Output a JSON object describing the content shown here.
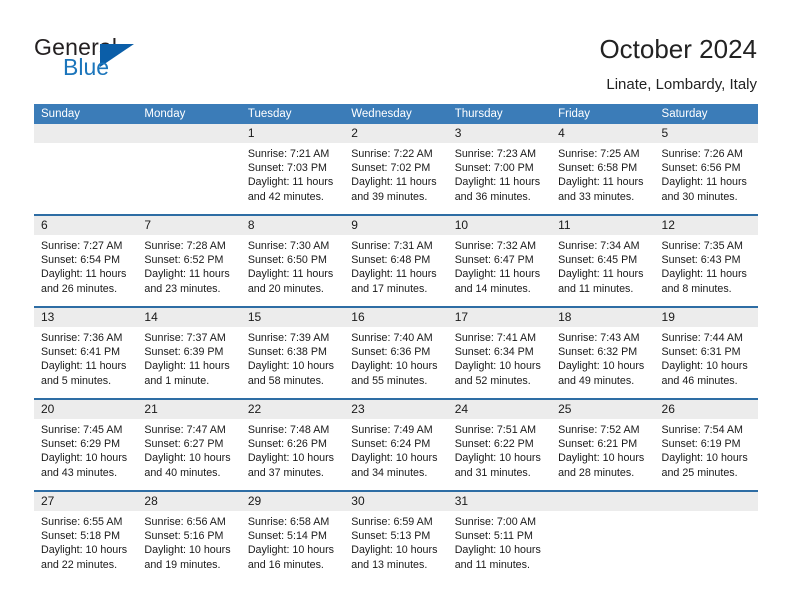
{
  "brand": {
    "name_top": "General",
    "name_bottom": "Blue",
    "triangle_color": "#0b5ea8",
    "blue_text_color": "#1b75bb"
  },
  "header": {
    "title": "October 2024",
    "location": "Linate, Lombardy, Italy"
  },
  "theme": {
    "header_bar": "#3b7cb8",
    "row_divider": "#2e6da4",
    "daynum_bg": "#ececec",
    "text": "#1a1a1a"
  },
  "weekdays": [
    "Sunday",
    "Monday",
    "Tuesday",
    "Wednesday",
    "Thursday",
    "Friday",
    "Saturday"
  ],
  "labels": {
    "sunrise": "Sunrise:",
    "sunset": "Sunset:",
    "daylight": "Daylight:"
  },
  "weeks": [
    [
      {
        "day": "",
        "blank": true
      },
      {
        "day": "",
        "blank": true
      },
      {
        "day": "1",
        "sunrise": "Sunrise: 7:21 AM",
        "sunset": "Sunset: 7:03 PM",
        "daylight1": "Daylight: 11 hours",
        "daylight2": "and 42 minutes."
      },
      {
        "day": "2",
        "sunrise": "Sunrise: 7:22 AM",
        "sunset": "Sunset: 7:02 PM",
        "daylight1": "Daylight: 11 hours",
        "daylight2": "and 39 minutes."
      },
      {
        "day": "3",
        "sunrise": "Sunrise: 7:23 AM",
        "sunset": "Sunset: 7:00 PM",
        "daylight1": "Daylight: 11 hours",
        "daylight2": "and 36 minutes."
      },
      {
        "day": "4",
        "sunrise": "Sunrise: 7:25 AM",
        "sunset": "Sunset: 6:58 PM",
        "daylight1": "Daylight: 11 hours",
        "daylight2": "and 33 minutes."
      },
      {
        "day": "5",
        "sunrise": "Sunrise: 7:26 AM",
        "sunset": "Sunset: 6:56 PM",
        "daylight1": "Daylight: 11 hours",
        "daylight2": "and 30 minutes."
      }
    ],
    [
      {
        "day": "6",
        "sunrise": "Sunrise: 7:27 AM",
        "sunset": "Sunset: 6:54 PM",
        "daylight1": "Daylight: 11 hours",
        "daylight2": "and 26 minutes."
      },
      {
        "day": "7",
        "sunrise": "Sunrise: 7:28 AM",
        "sunset": "Sunset: 6:52 PM",
        "daylight1": "Daylight: 11 hours",
        "daylight2": "and 23 minutes."
      },
      {
        "day": "8",
        "sunrise": "Sunrise: 7:30 AM",
        "sunset": "Sunset: 6:50 PM",
        "daylight1": "Daylight: 11 hours",
        "daylight2": "and 20 minutes."
      },
      {
        "day": "9",
        "sunrise": "Sunrise: 7:31 AM",
        "sunset": "Sunset: 6:48 PM",
        "daylight1": "Daylight: 11 hours",
        "daylight2": "and 17 minutes."
      },
      {
        "day": "10",
        "sunrise": "Sunrise: 7:32 AM",
        "sunset": "Sunset: 6:47 PM",
        "daylight1": "Daylight: 11 hours",
        "daylight2": "and 14 minutes."
      },
      {
        "day": "11",
        "sunrise": "Sunrise: 7:34 AM",
        "sunset": "Sunset: 6:45 PM",
        "daylight1": "Daylight: 11 hours",
        "daylight2": "and 11 minutes."
      },
      {
        "day": "12",
        "sunrise": "Sunrise: 7:35 AM",
        "sunset": "Sunset: 6:43 PM",
        "daylight1": "Daylight: 11 hours",
        "daylight2": "and 8 minutes."
      }
    ],
    [
      {
        "day": "13",
        "sunrise": "Sunrise: 7:36 AM",
        "sunset": "Sunset: 6:41 PM",
        "daylight1": "Daylight: 11 hours",
        "daylight2": "and 5 minutes."
      },
      {
        "day": "14",
        "sunrise": "Sunrise: 7:37 AM",
        "sunset": "Sunset: 6:39 PM",
        "daylight1": "Daylight: 11 hours",
        "daylight2": "and 1 minute."
      },
      {
        "day": "15",
        "sunrise": "Sunrise: 7:39 AM",
        "sunset": "Sunset: 6:38 PM",
        "daylight1": "Daylight: 10 hours",
        "daylight2": "and 58 minutes."
      },
      {
        "day": "16",
        "sunrise": "Sunrise: 7:40 AM",
        "sunset": "Sunset: 6:36 PM",
        "daylight1": "Daylight: 10 hours",
        "daylight2": "and 55 minutes."
      },
      {
        "day": "17",
        "sunrise": "Sunrise: 7:41 AM",
        "sunset": "Sunset: 6:34 PM",
        "daylight1": "Daylight: 10 hours",
        "daylight2": "and 52 minutes."
      },
      {
        "day": "18",
        "sunrise": "Sunrise: 7:43 AM",
        "sunset": "Sunset: 6:32 PM",
        "daylight1": "Daylight: 10 hours",
        "daylight2": "and 49 minutes."
      },
      {
        "day": "19",
        "sunrise": "Sunrise: 7:44 AM",
        "sunset": "Sunset: 6:31 PM",
        "daylight1": "Daylight: 10 hours",
        "daylight2": "and 46 minutes."
      }
    ],
    [
      {
        "day": "20",
        "sunrise": "Sunrise: 7:45 AM",
        "sunset": "Sunset: 6:29 PM",
        "daylight1": "Daylight: 10 hours",
        "daylight2": "and 43 minutes."
      },
      {
        "day": "21",
        "sunrise": "Sunrise: 7:47 AM",
        "sunset": "Sunset: 6:27 PM",
        "daylight1": "Daylight: 10 hours",
        "daylight2": "and 40 minutes."
      },
      {
        "day": "22",
        "sunrise": "Sunrise: 7:48 AM",
        "sunset": "Sunset: 6:26 PM",
        "daylight1": "Daylight: 10 hours",
        "daylight2": "and 37 minutes."
      },
      {
        "day": "23",
        "sunrise": "Sunrise: 7:49 AM",
        "sunset": "Sunset: 6:24 PM",
        "daylight1": "Daylight: 10 hours",
        "daylight2": "and 34 minutes."
      },
      {
        "day": "24",
        "sunrise": "Sunrise: 7:51 AM",
        "sunset": "Sunset: 6:22 PM",
        "daylight1": "Daylight: 10 hours",
        "daylight2": "and 31 minutes."
      },
      {
        "day": "25",
        "sunrise": "Sunrise: 7:52 AM",
        "sunset": "Sunset: 6:21 PM",
        "daylight1": "Daylight: 10 hours",
        "daylight2": "and 28 minutes."
      },
      {
        "day": "26",
        "sunrise": "Sunrise: 7:54 AM",
        "sunset": "Sunset: 6:19 PM",
        "daylight1": "Daylight: 10 hours",
        "daylight2": "and 25 minutes."
      }
    ],
    [
      {
        "day": "27",
        "sunrise": "Sunrise: 6:55 AM",
        "sunset": "Sunset: 5:18 PM",
        "daylight1": "Daylight: 10 hours",
        "daylight2": "and 22 minutes."
      },
      {
        "day": "28",
        "sunrise": "Sunrise: 6:56 AM",
        "sunset": "Sunset: 5:16 PM",
        "daylight1": "Daylight: 10 hours",
        "daylight2": "and 19 minutes."
      },
      {
        "day": "29",
        "sunrise": "Sunrise: 6:58 AM",
        "sunset": "Sunset: 5:14 PM",
        "daylight1": "Daylight: 10 hours",
        "daylight2": "and 16 minutes."
      },
      {
        "day": "30",
        "sunrise": "Sunrise: 6:59 AM",
        "sunset": "Sunset: 5:13 PM",
        "daylight1": "Daylight: 10 hours",
        "daylight2": "and 13 minutes."
      },
      {
        "day": "31",
        "sunrise": "Sunrise: 7:00 AM",
        "sunset": "Sunset: 5:11 PM",
        "daylight1": "Daylight: 10 hours",
        "daylight2": "and 11 minutes."
      },
      {
        "day": "",
        "blank": true
      },
      {
        "day": "",
        "blank": true
      }
    ]
  ]
}
